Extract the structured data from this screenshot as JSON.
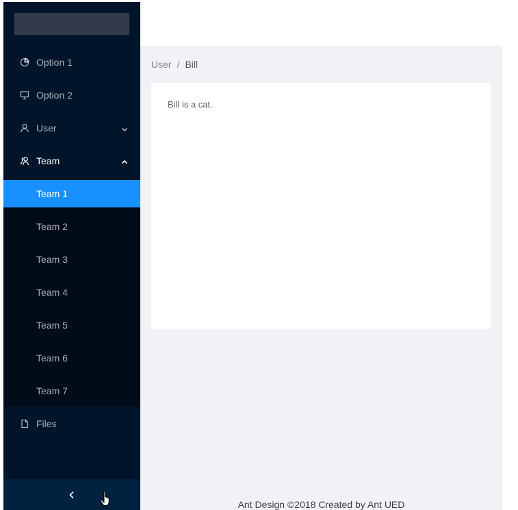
{
  "sider": {
    "menu": [
      {
        "label": "Option 1",
        "icon": "pie-chart-icon"
      },
      {
        "label": "Option 2",
        "icon": "desktop-icon"
      },
      {
        "label": "User",
        "icon": "user-icon",
        "expanded": false
      },
      {
        "label": "Team",
        "icon": "team-icon",
        "expanded": true
      },
      {
        "label": "Files",
        "icon": "file-icon"
      }
    ],
    "team_submenu": [
      "Team 1",
      "Team 2",
      "Team 3",
      "Team 4",
      "Team 5",
      "Team 6",
      "Team 7"
    ],
    "selected": "Team 1",
    "trigger_icon": "chevron-left-icon"
  },
  "breadcrumb": {
    "items": [
      "User",
      "Bill"
    ],
    "separator": "/"
  },
  "content": {
    "text": "Bill is a cat."
  },
  "footer": {
    "text": "Ant Design ©2018 Created by Ant UED"
  },
  "colors": {
    "sider_bg": "#001529",
    "submenu_bg": "#000c17",
    "trigger_bg": "#002140",
    "selected_bg": "#1890ff",
    "layout_bg": "#f0f2f5"
  }
}
